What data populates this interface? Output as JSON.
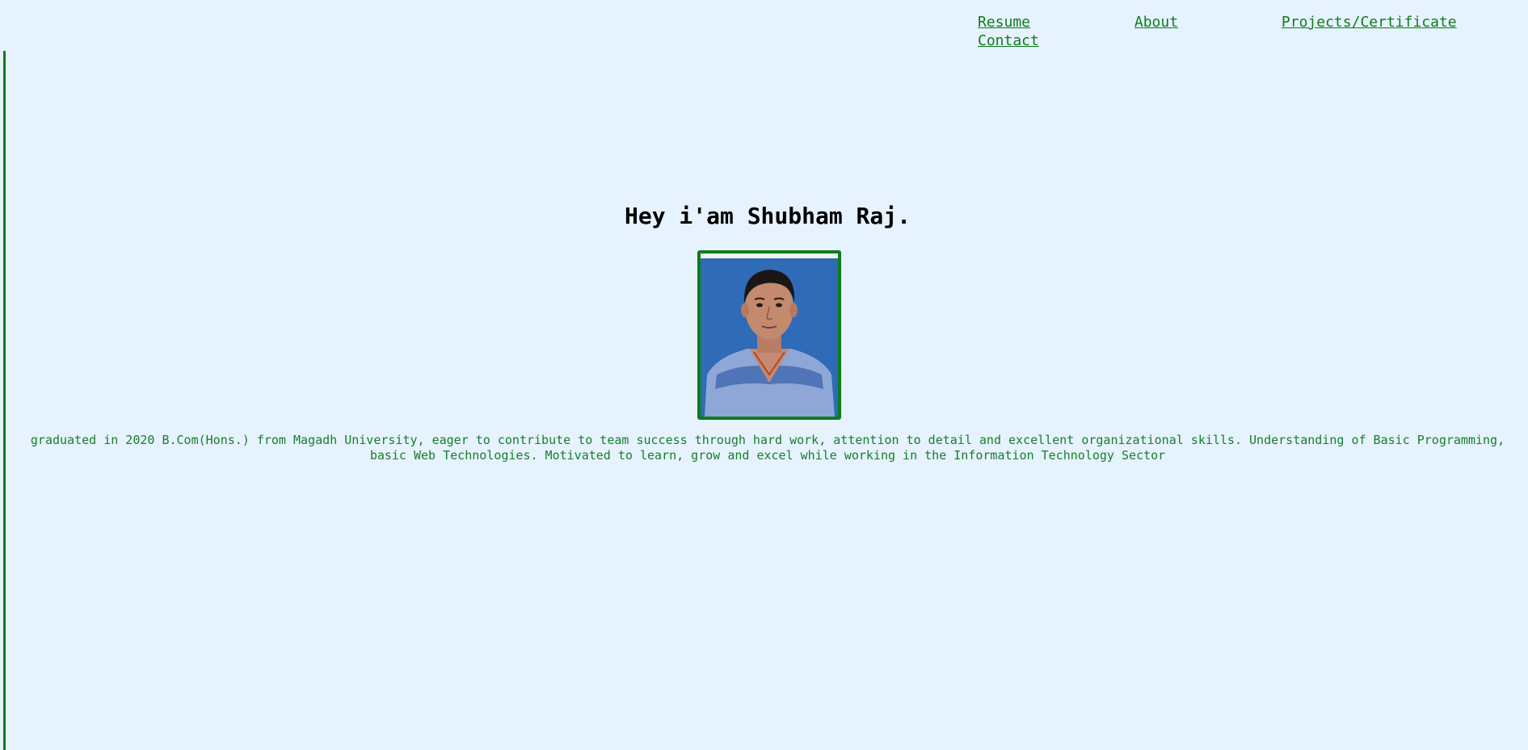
{
  "nav": {
    "resume": "Resume",
    "about": "About",
    "projects": "Projects/Certificate",
    "contact": "Contact"
  },
  "hero": {
    "title": "Hey i'am Shubham Raj."
  },
  "profile": {
    "bio": "graduated in 2020 B.Com(Hons.) from Magadh University, eager to contribute to team success through hard work, attention to detail and excellent organizational skills. Understanding of Basic Programming, basic Web Technologies. Motivated to learn, grow and excel while working in the Information Technology Sector"
  },
  "colors": {
    "accent": "#0d7d1a",
    "background": "#e6f2fe"
  }
}
